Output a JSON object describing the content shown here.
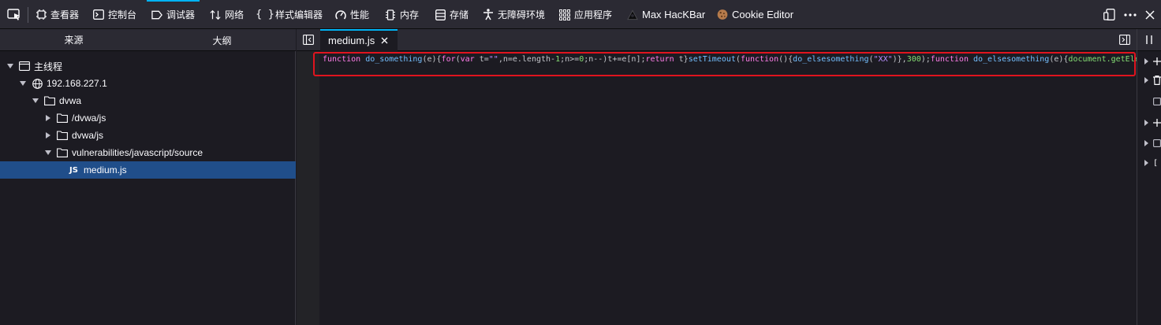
{
  "toolbar": {
    "tabs": [
      {
        "label": "查看器",
        "icon": "inspector-icon"
      },
      {
        "label": "控制台",
        "icon": "console-icon"
      },
      {
        "label": "调试器",
        "icon": "debugger-icon",
        "active": true
      },
      {
        "label": "网络",
        "icon": "network-icon"
      },
      {
        "label": "样式编辑器",
        "icon": "style-editor-icon"
      },
      {
        "label": "性能",
        "icon": "performance-icon"
      },
      {
        "label": "内存",
        "icon": "memory-icon"
      },
      {
        "label": "存储",
        "icon": "storage-icon"
      },
      {
        "label": "无障碍环境",
        "icon": "accessibility-icon"
      },
      {
        "label": "应用程序",
        "icon": "application-icon"
      },
      {
        "label": "Max HacKBar",
        "icon": "hackbar-icon"
      },
      {
        "label": "Cookie Editor",
        "icon": "cookie-icon"
      }
    ],
    "brace_glyph": "{ }"
  },
  "left_panel": {
    "tabs": [
      "来源",
      "大纲"
    ],
    "tree": [
      {
        "label": "主线程",
        "depth": 0,
        "icon": "window-icon"
      },
      {
        "label": "192.168.227.1",
        "depth": 1,
        "icon": "globe-icon"
      },
      {
        "label": "dvwa",
        "depth": 2,
        "icon": "folder-icon"
      },
      {
        "label": "/dvwa/js",
        "depth": 3,
        "icon": "folder-icon"
      },
      {
        "label": "dvwa/js",
        "depth": 3,
        "icon": "folder-icon"
      },
      {
        "label": "vulnerabilities/javascript/source",
        "depth": 3,
        "icon": "folder-icon"
      },
      {
        "label": "medium.js",
        "depth": 4,
        "badge": "JS",
        "selected": true
      }
    ]
  },
  "editor": {
    "tab_label": "medium.js",
    "code": {
      "t1": "function",
      "t2": " ",
      "t3": "do_something",
      "t4": "(e){",
      "t5": "for",
      "t6": "(",
      "t7": "var",
      "t8": " t=",
      "t9": "\"\"",
      "t10": ",n=e.length-",
      "t11": "1",
      "t12": ";n>=",
      "t13": "0",
      "t14": ";n--)t+=e[n];",
      "t15": "return",
      "t16": " t}",
      "t17": "setTimeout",
      "t18": "(",
      "t19": "function",
      "t20": "(){",
      "t21": "do_elsesomething",
      "t22": "(",
      "t23": "\"XX\"",
      "t24": ")},",
      "t25": "300",
      "t26": ");",
      "t27": "function",
      "t28": " ",
      "t29": "do_elsesomething",
      "t30": "(e){",
      "t31": "document",
      "t32": ".getEle"
    }
  },
  "right_panel": {
    "rows": [
      "",
      "",
      "",
      "[",
      "["
    ]
  }
}
